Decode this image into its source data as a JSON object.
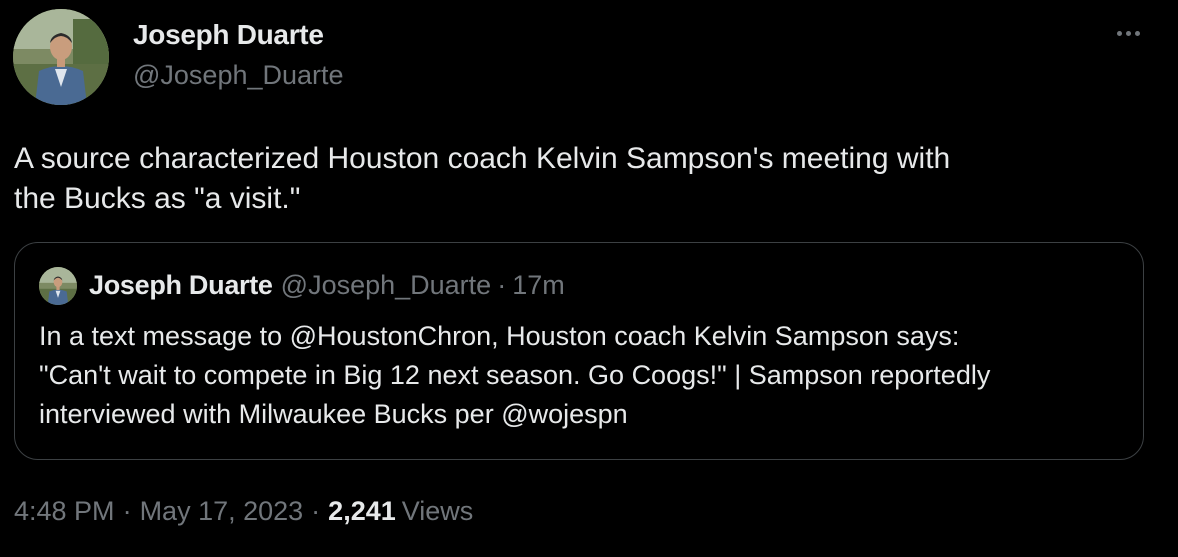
{
  "author": {
    "display_name": "Joseph Duarte",
    "handle": "@Joseph_Duarte"
  },
  "tweet": {
    "text_line1": "A source characterized Houston coach Kelvin Sampson's meeting with",
    "text_line2": "the Bucks as \"a visit.\""
  },
  "quote": {
    "display_name": "Joseph Duarte",
    "handle": "@Joseph_Duarte",
    "separator": "·",
    "time": "17m",
    "text_line1": "In a text message to @HoustonChron, Houston coach Kelvin Sampson says:",
    "text_line2": "\"Can't wait to compete in Big 12 next season. Go Coogs!\" | Sampson reportedly",
    "text_line3": "interviewed with Milwaukee Bucks per @wojespn"
  },
  "meta": {
    "time": "4:48 PM",
    "date": "May 17, 2023",
    "separator": "·",
    "views_count": "2,241",
    "views_label": "Views"
  },
  "icons": {
    "more": "more-horizontal-icon"
  },
  "colors": {
    "background": "#000000",
    "primary_text": "#e7e9ea",
    "secondary_text": "#71767b",
    "border": "#3c4043"
  }
}
